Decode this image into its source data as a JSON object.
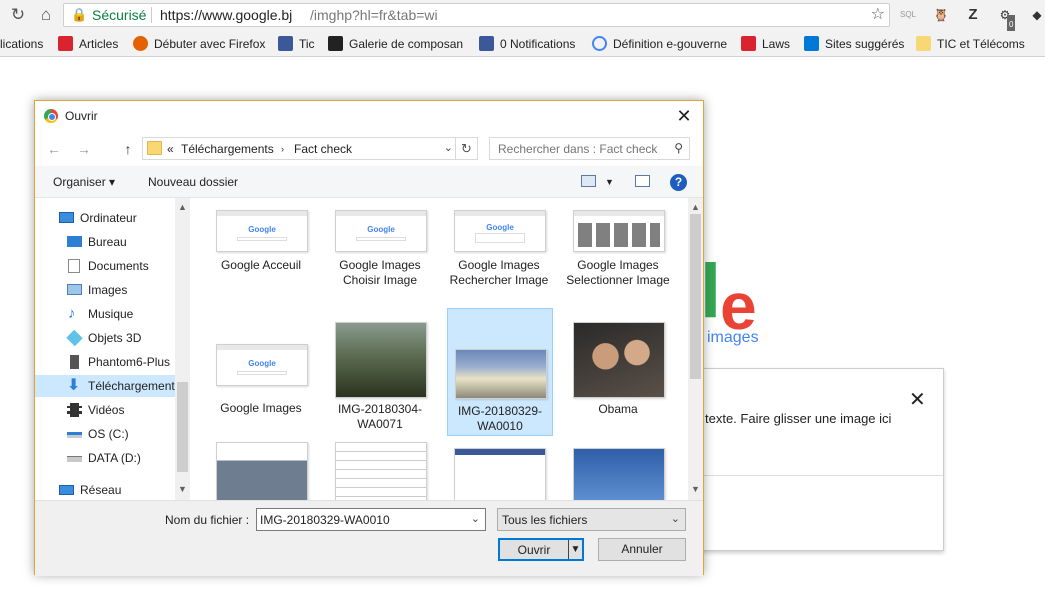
{
  "browser": {
    "secure_label": "Sécurisé",
    "url_host": "https://www.google.bj",
    "url_path": "/imghp?hl=fr&tab=wi",
    "ext_sql": "SQL",
    "ext_z": "Z",
    "ext_badge": "0"
  },
  "bookmarks": [
    {
      "label": "lications",
      "color": "#f2f2f2"
    },
    {
      "label": "Articles",
      "color": "#d9232e"
    },
    {
      "label": "Débuter avec Firefox",
      "color": "#e66000"
    },
    {
      "label": "Tic",
      "color": "#3b5998"
    },
    {
      "label": "Galerie de composan",
      "color": "#222222"
    },
    {
      "label": "0 Notifications",
      "color": "#3b5998"
    },
    {
      "label": "Définition e-gouverne",
      "color": "#ffffff"
    },
    {
      "label": "Laws",
      "color": "#d9232e"
    },
    {
      "label": "Sites suggérés",
      "color": "#0078d7"
    },
    {
      "label": "TIC et Télécoms",
      "color": "#f8d775"
    }
  ],
  "google_page": {
    "logo_l": "l",
    "logo_e": "e",
    "images_label": "images",
    "drop_hint": "texte. Faire glisser une image ici"
  },
  "dialog": {
    "title": "Ouvrir",
    "path_prefix": "«",
    "path": [
      "Téléchargements",
      "Fact check"
    ],
    "search_placeholder": "Rechercher dans : Fact check",
    "organize_label": "Organiser ▾",
    "new_folder_label": "Nouveau dossier",
    "help_label": "?",
    "tree": [
      {
        "label": "Ordinateur",
        "icon": "computer-icon",
        "indent": 0
      },
      {
        "label": "Bureau",
        "icon": "desktop-icon",
        "indent": 1
      },
      {
        "label": "Documents",
        "icon": "documents-icon",
        "indent": 1
      },
      {
        "label": "Images",
        "icon": "pictures-icon",
        "indent": 1
      },
      {
        "label": "Musique",
        "icon": "music-icon",
        "indent": 1
      },
      {
        "label": "Objets 3D",
        "icon": "cube-icon",
        "indent": 1
      },
      {
        "label": "Phantom6-Plus",
        "icon": "phone-icon",
        "indent": 1
      },
      {
        "label": "Téléchargements",
        "icon": "download-icon",
        "indent": 1,
        "selected": true
      },
      {
        "label": "Vidéos",
        "icon": "video-icon",
        "indent": 1
      },
      {
        "label": "OS (C:)",
        "icon": "drive-icon",
        "indent": 1
      },
      {
        "label": "DATA (D:)",
        "icon": "drive-icon",
        "indent": 1
      },
      {
        "label": "Réseau",
        "icon": "network-icon",
        "indent": 0
      }
    ],
    "files": [
      {
        "name": "Google Acceuil",
        "kind": "google"
      },
      {
        "name": "Google Images Choisir Image",
        "kind": "google"
      },
      {
        "name": "Google Images Rechercher Image",
        "kind": "google"
      },
      {
        "name": "Google Images Selectionner Image",
        "kind": "grid"
      },
      {
        "name": "Google Images",
        "kind": "google"
      },
      {
        "name": "IMG-20180304-WA0071",
        "kind": "photo"
      },
      {
        "name": "IMG-20180329-WA0010",
        "kind": "photo2",
        "selected": true
      },
      {
        "name": "Obama",
        "kind": "photo3"
      },
      {
        "name": "",
        "kind": "news"
      },
      {
        "name": "",
        "kind": "results"
      },
      {
        "name": "",
        "kind": "fb"
      },
      {
        "name": "",
        "kind": "blue"
      }
    ],
    "filename_label": "Nom du fichier :",
    "filename_value": "IMG-20180329-WA0010",
    "filetype_value": "Tous les fichiers",
    "open_label": "Ouvrir",
    "cancel_label": "Annuler"
  }
}
